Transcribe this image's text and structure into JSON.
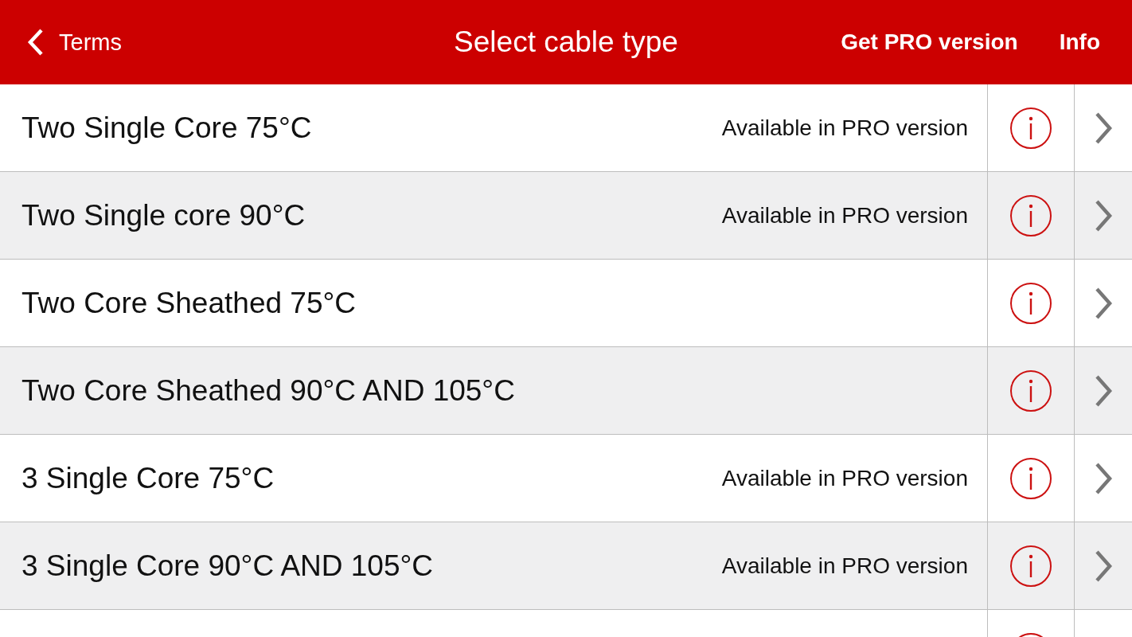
{
  "header": {
    "back": {
      "label": "Terms"
    },
    "title": "Select cable type",
    "actions": [
      "Get PRO version",
      "Info"
    ]
  },
  "rows": [
    {
      "label": "Two Single Core 75°C",
      "note": "Available in PRO version"
    },
    {
      "label": "Two Single core 90°C",
      "note": "Available in PRO version"
    },
    {
      "label": "Two Core Sheathed 75°C"
    },
    {
      "label": "Two Core Sheathed 90°C AND 105°C"
    },
    {
      "label": "3 Single Core 75°C",
      "note": "Available in PRO version"
    },
    {
      "label": "3 Single Core 90°C AND 105°C",
      "note": "Available in PRO version"
    },
    {}
  ]
}
